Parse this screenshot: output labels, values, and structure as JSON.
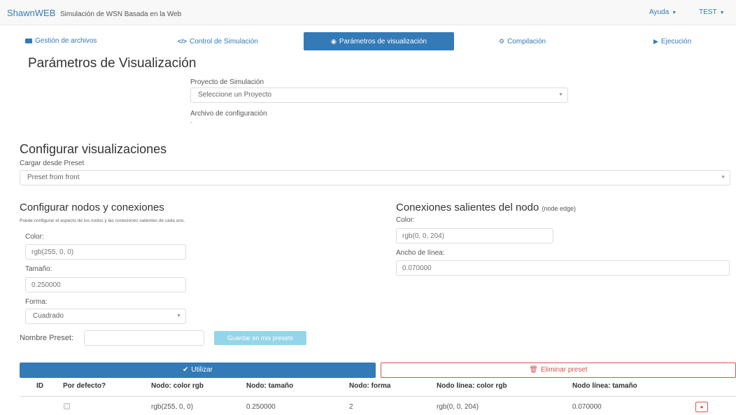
{
  "navbar": {
    "brand": "ShawnWEB",
    "subtitle": "Simulación de WSN Basada en la Web",
    "help_menu": "Ayuda",
    "user_menu": "TEST"
  },
  "tabs": [
    {
      "label": "Gestión de archivos",
      "icon": "folder-icon"
    },
    {
      "label": "Control de Simulación",
      "icon": "code-icon"
    },
    {
      "label": "Parámetros de visualización",
      "icon": "eye-icon",
      "active": true
    },
    {
      "label": "Compilación",
      "icon": "gear-icon"
    },
    {
      "label": "Ejecución",
      "icon": "play-icon"
    }
  ],
  "page": {
    "title": "Parámetros de Visualización",
    "project_label": "Proyecto de Simulación",
    "project_select": "Seleccione un Proyecto",
    "config_file_label": "Archivo de configuración",
    "config_file_value": "-"
  },
  "visualizations": {
    "title": "Configurar visualizaciones",
    "preset_label": "Cargar desde Preset",
    "preset_select": "Preset from front"
  },
  "nodes": {
    "title": "Configurar nodos y conexiones",
    "hint": "Puede configurar el aspecto de los nodos y las conexiones salientes de cada uno.",
    "color_label": "Color:",
    "color_value": "rgb(255, 0, 0)",
    "size_label": "Tamaño:",
    "size_value": "0.250000",
    "shape_label": "Forma:",
    "shape_value": "Cuadrado",
    "preset_name_label": "Nombre Preset:",
    "preset_name_value": "",
    "save_button": "Guardar en mis presets"
  },
  "edges": {
    "title": "Conexiones salientes del nodo",
    "title_small": "(node edge)",
    "color_label": "Color:",
    "color_value": "rgb(0, 0, 204)",
    "width_label": "Ancho de línea:",
    "width_value": "0.070000"
  },
  "actions": {
    "use_button": "Utilizar",
    "delete_button": "Eliminar preset"
  },
  "table": {
    "headers": [
      "ID",
      "Por defecto?",
      "Nodo: color rgb",
      "Nodo: tamaño",
      "Nodo: forma",
      "Nodo línea: color rgb",
      "Nodo línea: tamaño"
    ],
    "rows": [
      {
        "id": "",
        "default": false,
        "node_color": "rgb(255, 0, 0)",
        "node_size": "0.250000",
        "node_shape": "2",
        "line_color": "rgb(0, 0, 204)",
        "line_size": "0.070000"
      }
    ]
  },
  "colors": {
    "primary": "#337ab7",
    "danger": "#d9534f",
    "info": "#5bc0de"
  }
}
